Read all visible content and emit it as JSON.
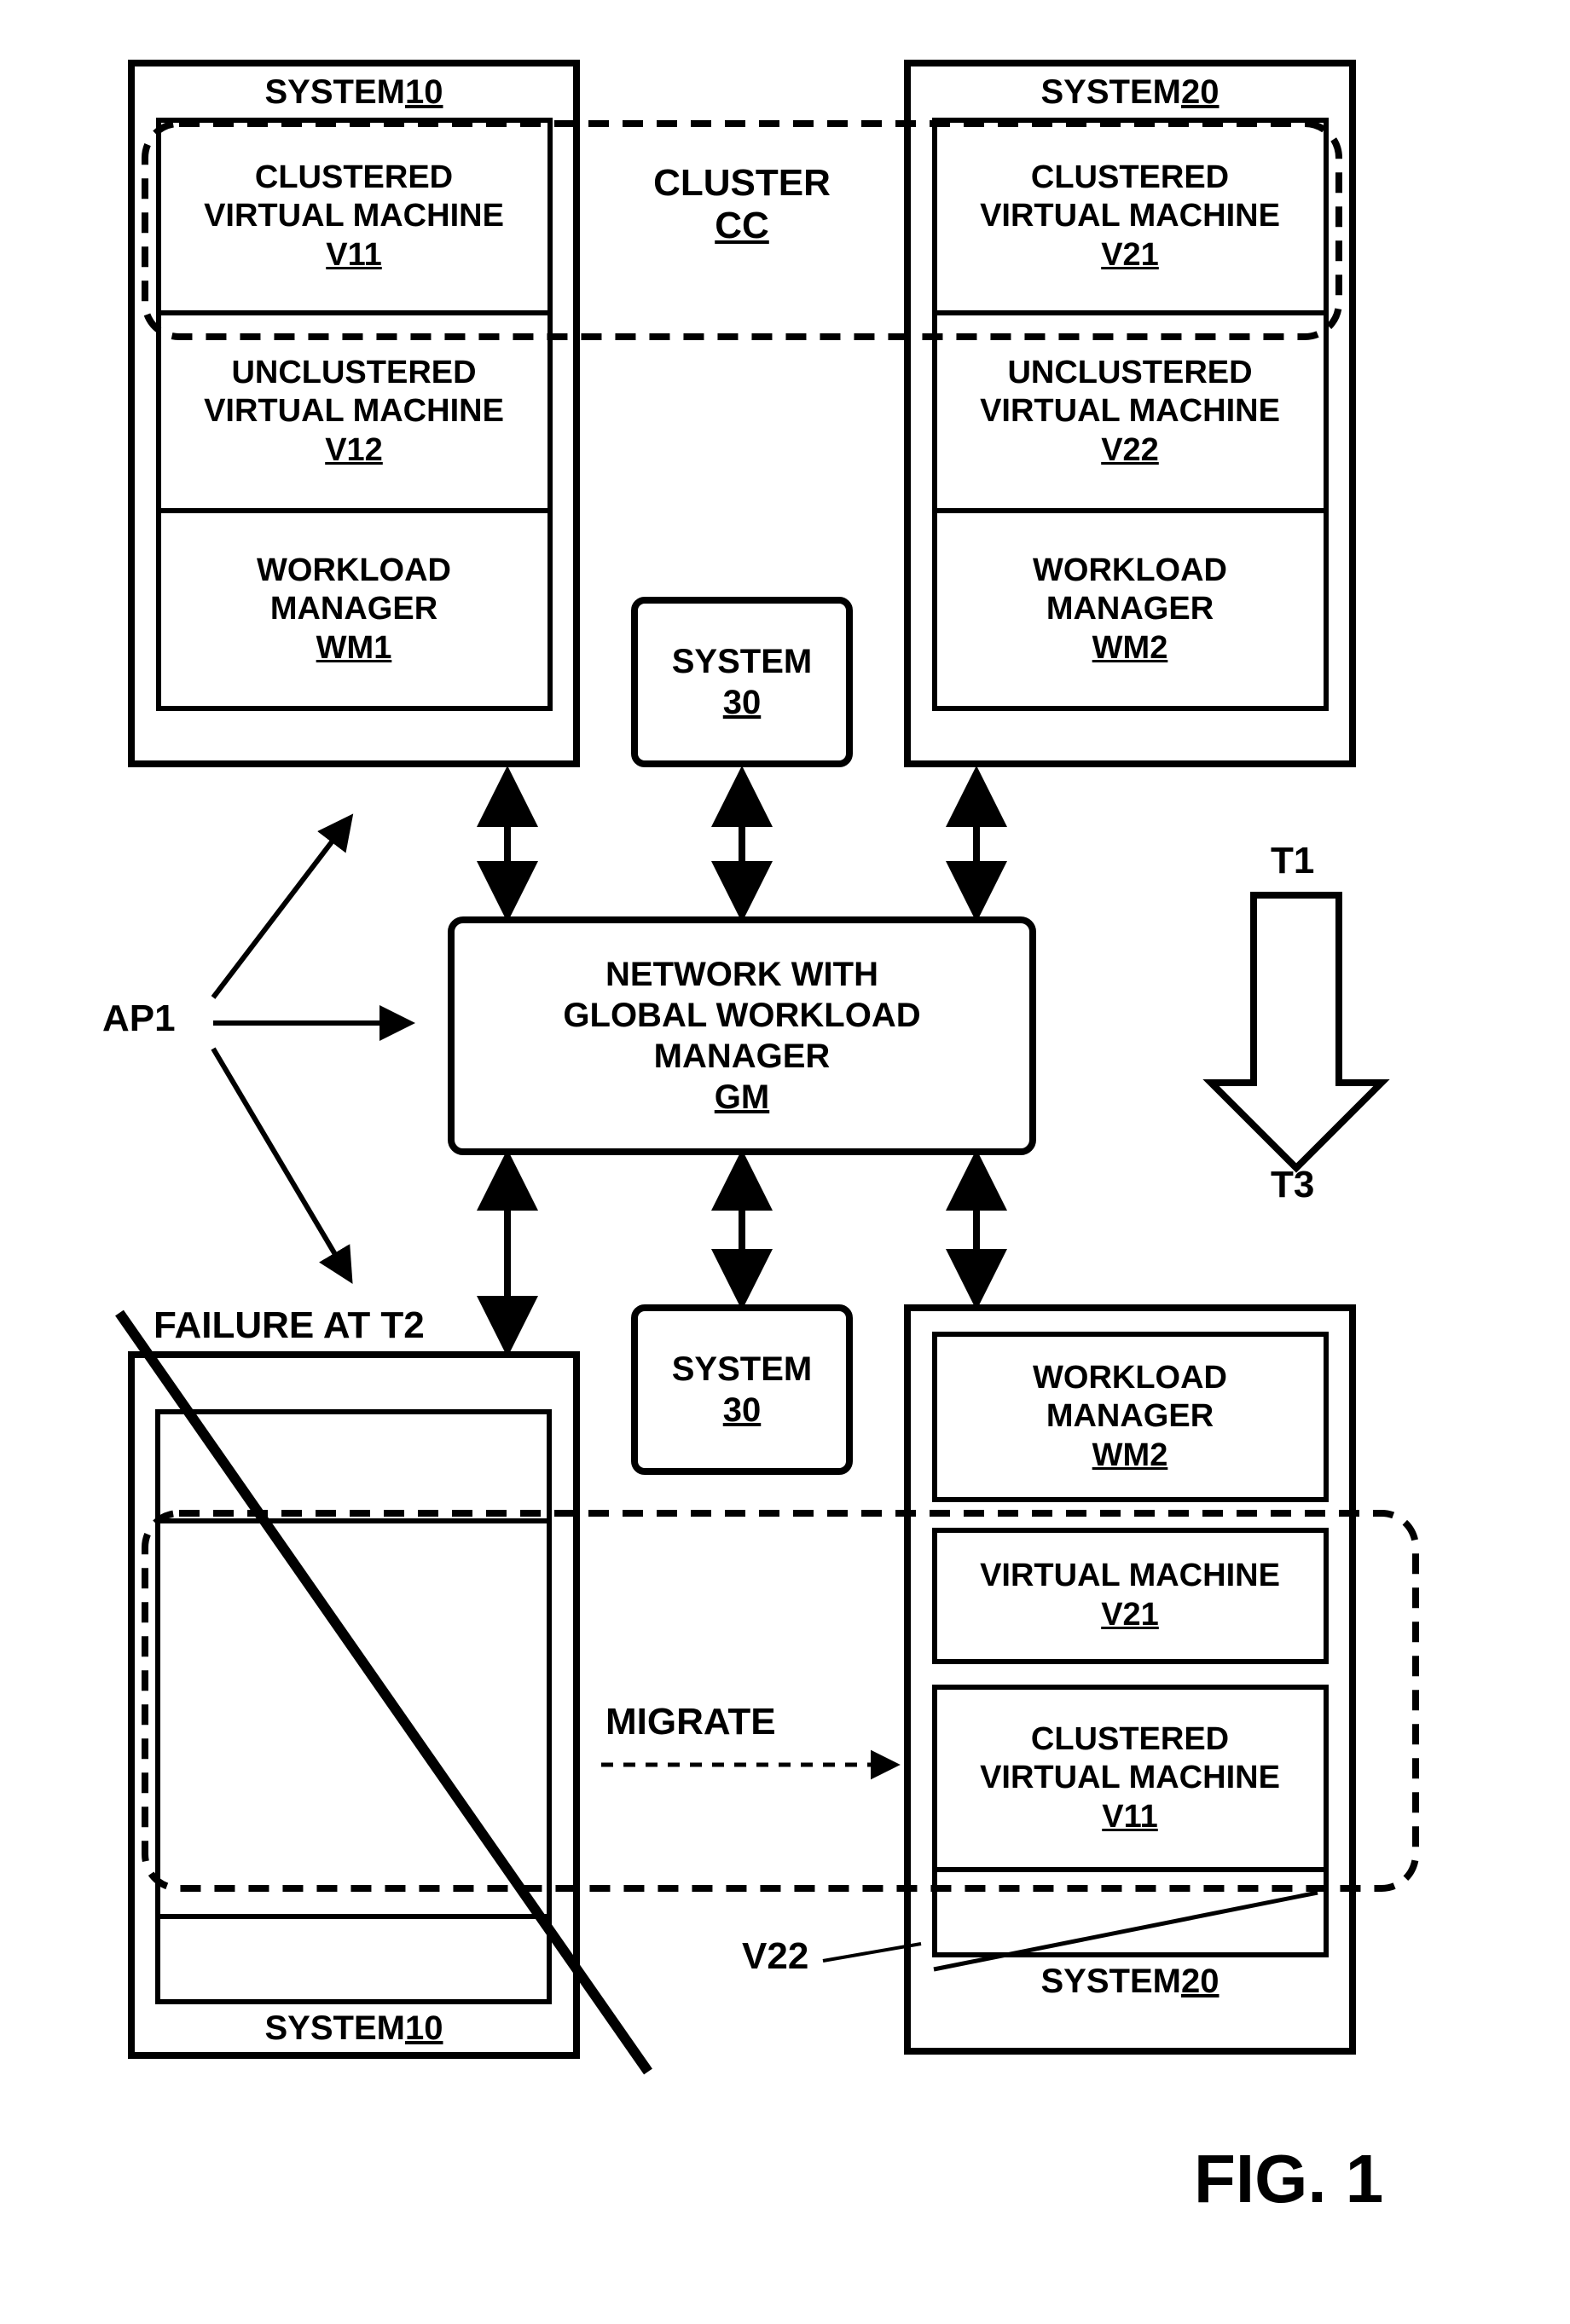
{
  "top": {
    "system10": {
      "title_prefix": "SYSTEM ",
      "title_ref": "10",
      "v11_l1": "CLUSTERED",
      "v11_l2": "VIRTUAL MACHINE",
      "v11_ref": "V11",
      "v12_l1": "UNCLUSTERED",
      "v12_l2": "VIRTUAL MACHINE",
      "v12_ref": "V12",
      "wm1_l1": "WORKLOAD",
      "wm1_l2": "MANAGER",
      "wm1_ref": "WM1"
    },
    "system20": {
      "title_prefix": "SYSTEM ",
      "title_ref": "20",
      "v21_l1": "CLUSTERED",
      "v21_l2": "VIRTUAL MACHINE",
      "v21_ref": "V21",
      "v22_l1": "UNCLUSTERED",
      "v22_l2": "VIRTUAL MACHINE",
      "v22_ref": "V22",
      "wm2_l1": "WORKLOAD",
      "wm2_l2": "MANAGER",
      "wm2_ref": "WM2"
    },
    "system30": {
      "title": "SYSTEM",
      "ref": "30"
    },
    "cluster_label": "CLUSTER",
    "cluster_ref": "CC"
  },
  "center": {
    "gm_l1": "NETWORK WITH",
    "gm_l2": "GLOBAL WORKLOAD",
    "gm_l3": "MANAGER",
    "gm_ref": "GM"
  },
  "bottom": {
    "system10": {
      "title_prefix": "SYSTEM ",
      "title_ref": "10"
    },
    "system20": {
      "title_prefix": "SYSTEM ",
      "title_ref": "20",
      "wm2_l1": "WORKLOAD",
      "wm2_l2": "MANAGER",
      "wm2_ref": "WM2",
      "v21_l1": "VIRTUAL MACHINE",
      "v21_ref": "V21",
      "v11_l1": "CLUSTERED",
      "v11_l2": "VIRTUAL MACHINE",
      "v11_ref": "V11"
    },
    "system30": {
      "title": "SYSTEM",
      "ref": "30"
    },
    "failure_label": "FAILURE AT T2",
    "migrate_label": "MIGRATE",
    "v22_label": "V22"
  },
  "annotations": {
    "ap1": "AP1",
    "t1": "T1",
    "t3": "T3"
  },
  "figure": "FIG. 1"
}
